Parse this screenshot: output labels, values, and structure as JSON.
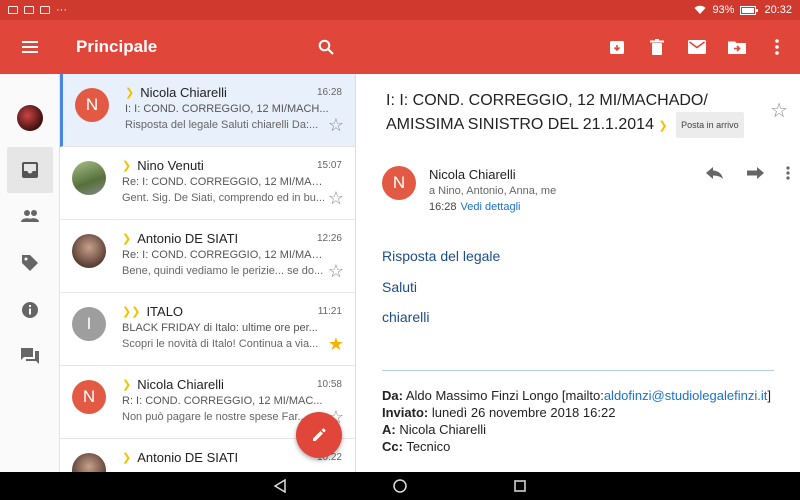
{
  "status_bar": {
    "time": "20:32",
    "battery": "93%"
  },
  "app_bar": {
    "title": "Principale",
    "menu_icon": "menu-icon",
    "search_icon": "search-icon",
    "actions": [
      "archive-icon",
      "delete-icon",
      "mark-unread-icon",
      "move-to-icon",
      "more-vert-icon"
    ]
  },
  "rail": {
    "items": [
      "account-avatar",
      "inbox-icon",
      "people-icon",
      "label-icon",
      "info-icon",
      "forum-icon"
    ]
  },
  "emails": [
    {
      "initial": "N",
      "avatar_color": "#e35a44",
      "sender": "Nicola Chiarelli",
      "time": "16:28",
      "subject": "I: I: COND. CORREGGIO, 12 MI/MACH...",
      "snippet": "Risposta del legale Saluti chiarelli Da:...",
      "starred": false,
      "selected": true
    },
    {
      "initial": "",
      "avatar_color": "#6f8a4f",
      "sender": "Nino Venuti",
      "time": "15:07",
      "subject": "Re: I: COND. CORREGGIO, 12 MI/MAC...",
      "snippet": "Gent. Sig. De Siati, comprendo ed in bu...",
      "starred": false,
      "selected": false
    },
    {
      "initial": "",
      "avatar_color": "#8b6b5a",
      "sender": "Antonio DE SIATI",
      "time": "12:26",
      "subject": "Re: I: COND. CORREGGIO, 12 MI/MAC...",
      "snippet": "Bene, quindi vediamo le perizie... se do...",
      "starred": false,
      "selected": false
    },
    {
      "initial": "I",
      "avatar_color": "#9e9e9e",
      "sender": "ITALO",
      "time": "11:21",
      "subject": "BLACK FRIDAY di Italo: ultime ore per...",
      "snippet": "Scopri le novità di Italo! Continua a via...",
      "starred": true,
      "selected": false
    },
    {
      "initial": "N",
      "avatar_color": "#e35a44",
      "sender": "Nicola Chiarelli",
      "time": "10:58",
      "subject": "R: I: COND. CORREGGIO, 12 MI/MAC...",
      "snippet": "Non può pagare le nostre spese Far...",
      "starred": false,
      "selected": false
    },
    {
      "initial": "",
      "avatar_color": "#8b6b5a",
      "sender": "Antonio DE SIATI",
      "time": "10:22",
      "subject": "",
      "snippet": "",
      "starred": false,
      "selected": false
    }
  ],
  "detail": {
    "subject": "I: I: COND. CORREGGIO, 12 MI/MACHADO/ AMISSIMA SINISTRO DEL 21.1.2014",
    "label": "Posta in arrivo",
    "from_initial": "N",
    "from_name": "Nicola Chiarelli",
    "to": "a Nino, Antonio, Anna, me",
    "time": "16:28",
    "details_link": "Vedi dettagli",
    "body": [
      "Risposta del legale",
      "Saluti",
      "chiarelli"
    ],
    "quote": {
      "da_label": "Da:",
      "da_value": " Aldo Massimo Finzi Longo [mailto:",
      "da_link": "aldofinzi@studiolegalefinzi.it",
      "da_close": "]",
      "inviato_label": "Inviato:",
      "inviato_value": " lunedì 26 novembre 2018 16:22",
      "a_label": "A:",
      "a_value": " Nicola Chiarelli",
      "cc_label": "Cc:",
      "cc_value": " Tecnico"
    }
  },
  "colors": {
    "app_bar": "#e0463a",
    "status_bar": "#d03a2e",
    "accent_link": "#1a73c8",
    "star_on": "#f5b400"
  }
}
